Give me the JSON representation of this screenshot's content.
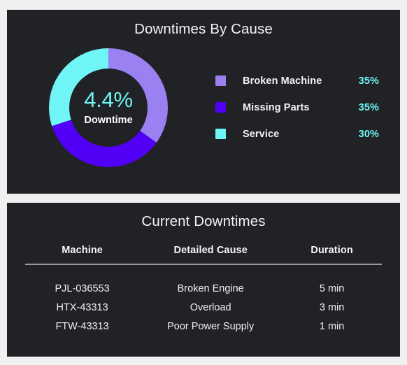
{
  "theme": {
    "page_background": "#f0f0f0",
    "panel_background": "#212226",
    "text_primary": "#f2f2f2",
    "accent_cyan": "#6ff5f5",
    "divider": "#9a9a9a"
  },
  "downtimes_by_cause": {
    "title": "Downtimes By Cause",
    "center_value": "4.4%",
    "center_label": "Downtime",
    "legend": [
      {
        "label": "Broken Machine",
        "percent": "35%",
        "color": "#9a80f0"
      },
      {
        "label": "Missing Parts",
        "percent": "35%",
        "color": "#5200f5"
      },
      {
        "label": "Service",
        "percent": "30%",
        "color": "#6ff5f5"
      }
    ]
  },
  "current_downtimes": {
    "title": "Current Downtimes",
    "columns": [
      "Machine",
      "Detailed Cause",
      "Duration"
    ],
    "rows": [
      {
        "machine": "PJL-036553",
        "cause": "Broken Engine",
        "duration": "5 min"
      },
      {
        "machine": "HTX-43313",
        "cause": "Overload",
        "duration": "3 min"
      },
      {
        "machine": "FTW-43313",
        "cause": "Poor Power Supply",
        "duration": "1 min"
      }
    ]
  },
  "chart_data": {
    "type": "pie",
    "title": "Downtimes By Cause",
    "subtitle": "4.4% Downtime",
    "categories": [
      "Broken Machine",
      "Missing Parts",
      "Service"
    ],
    "values": [
      35,
      35,
      30
    ],
    "value_labels": [
      "35%",
      "35%",
      "30%"
    ],
    "colors": [
      "#9a80f0",
      "#5200f5",
      "#6ff5f5"
    ],
    "donut": true,
    "hole_ratio": 0.66,
    "start_angle_deg": 0,
    "direction": "clockwise",
    "center_text": "4.4%",
    "center_subtext": "Downtime",
    "legend_position": "right",
    "units": "percent"
  }
}
